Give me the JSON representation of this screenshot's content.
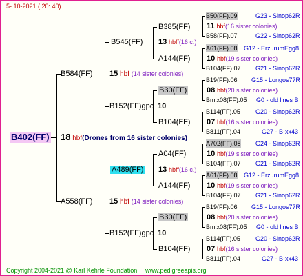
{
  "header": {
    "date": "5- 10-2021 ( 20: 40)"
  },
  "footer": {
    "copyright": "Copyright 2004-2021 @ Karl Kehrle Foundation",
    "url": "www.pedigreeapis.org"
  },
  "root": {
    "label": "B402(FF)",
    "number": "18",
    "hbf": "hbf",
    "note": "(Drones from 16 sister colonies)"
  },
  "g1": [
    {
      "label": "B584(FF)",
      "number": "15",
      "hbf": "hbf",
      "note": "(14 sister colonies)"
    },
    {
      "label": "A558(FF)",
      "number": "15",
      "hbf": "hbf",
      "note": "(14 sister colonies)"
    }
  ],
  "g2": [
    {
      "label": "B545(FF)",
      "number": "13",
      "hbf": "hbff",
      "note": "(16 c.)"
    },
    {
      "label": "B152(FF)gpc",
      "number": "10"
    },
    {
      "label": "A489(FF)",
      "number": "13",
      "hbf": "hbff",
      "note": "(16 c.)"
    },
    {
      "label": "B152(FF)gpc",
      "number": "10"
    }
  ],
  "g3": [
    {
      "label": "B385(FF)",
      "number": "11",
      "hbf": "hbf",
      "note": "(16 sister colonies)"
    },
    {
      "label": "A144(FF)",
      "number": "10",
      "hbf": "hbf",
      "note": "(19 sister colonies)"
    },
    {
      "label": "B30(FF)",
      "number": "08",
      "hbf": "hbf",
      "note": "(20 sister colonies)"
    },
    {
      "label": "B104(FF)",
      "number": "07",
      "hbf": "hbf",
      "note": "(16 sister colonies)"
    },
    {
      "label": "A04(FF)",
      "number": "10",
      "hbf": "hbf",
      "note": "(19 sister colonies)"
    },
    {
      "label": "A144(FF)",
      "number": "10",
      "hbf": "hbf",
      "note": "(19 sister colonies)"
    },
    {
      "label": "B30(FF)",
      "number": "08",
      "hbf": "hbf",
      "note": "(20 sister colonies)"
    },
    {
      "label": "B104(FF)",
      "number": "07",
      "hbf": "hbf",
      "note": "(16 sister colonies)"
    }
  ],
  "g4": [
    {
      "label": "B50(FF).09",
      "code": "G23 - Sinop62R"
    },
    {
      "label": "B58(FF).07",
      "code": "G22 - Sinop62R"
    },
    {
      "label": "A61(FF).08",
      "code": "G12 - ErzurumEgg8"
    },
    {
      "label": "B104(FF).07",
      "code": "G21 - Sinop62R"
    },
    {
      "label": "B19(FF).06",
      "code": "G15 - Longos77R"
    },
    {
      "label": "Bmix08(FF).05",
      "code": "G0 - old lines B"
    },
    {
      "label": "B114(FF).05",
      "code": "G20 - Sinop62R"
    },
    {
      "label": "B811(FF).04",
      "code": "G27 - B-xx43"
    },
    {
      "label": "A702(FF).08",
      "code": "G24 - Sinop62R"
    },
    {
      "label": "B104(FF).07",
      "code": "G21 - Sinop62R"
    },
    {
      "label": "A61(FF).08",
      "code": "G12 - ErzurumEgg8"
    },
    {
      "label": "B104(FF).07",
      "code": "G21 - Sinop62R"
    },
    {
      "label": "B19(FF).06",
      "code": "G15 - Longos77R"
    },
    {
      "label": "Bmix08(FF).05",
      "code": "G0 - old lines B"
    },
    {
      "label": "B114(FF).05",
      "code": "G20 - Sinop62R"
    },
    {
      "label": "B811(FF).04",
      "code": "G27 - B-xx43"
    }
  ]
}
